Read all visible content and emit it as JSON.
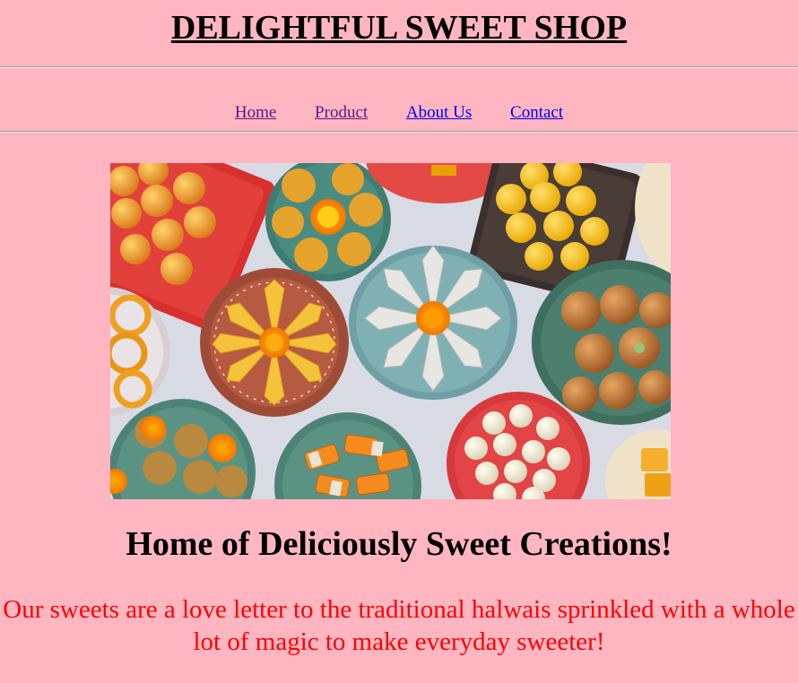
{
  "header": {
    "title": "DELIGHTFUL SWEET SHOP"
  },
  "nav": {
    "items": [
      {
        "label": "Home",
        "state": "visited",
        "color": "#551a8b"
      },
      {
        "label": "Product",
        "state": "visited",
        "color": "#551a8b"
      },
      {
        "label": "About Us",
        "state": "unvisited",
        "color": "#0000ee"
      },
      {
        "label": "Contact",
        "state": "unvisited",
        "color": "#0000ee"
      }
    ]
  },
  "hero": {
    "image_subject": "assorted Indian sweets on colorful plates",
    "plates": [
      "laddoo",
      "peda",
      "kaju katli",
      "jalebi",
      "badusha",
      "mysore pak",
      "rasgulla",
      "kalakand"
    ]
  },
  "content": {
    "headline": "Home of Deliciously Sweet Creations!",
    "tagline": "Our sweets are a love letter to the traditional halwais sprinkled with a whole lot of magic to make everyday sweeter!"
  },
  "colors": {
    "background": "#ffb6c1",
    "tagline": "#ff0000",
    "link_visited": "#551a8b",
    "link_unvisited": "#0000ee"
  }
}
